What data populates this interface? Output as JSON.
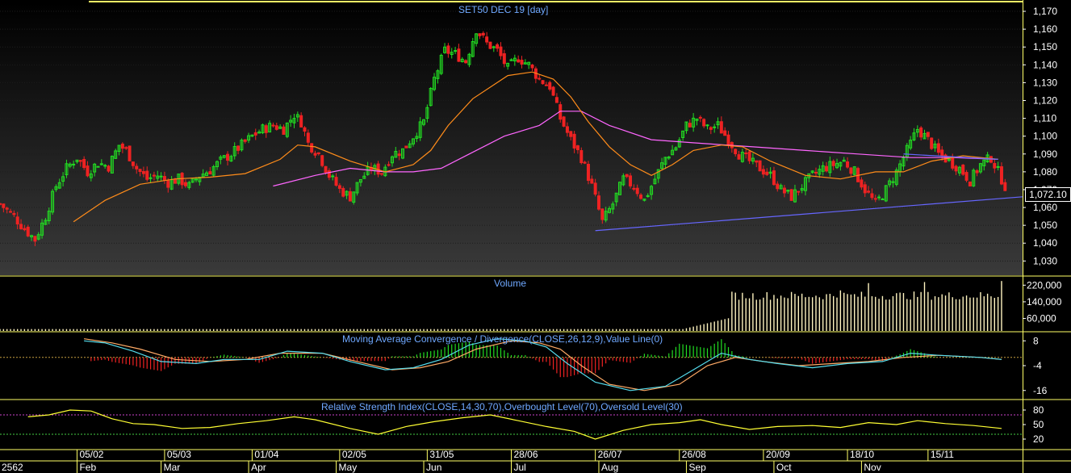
{
  "panels": {
    "price_title": "SET50 DEC 19   [day]",
    "volume_title": "Volume",
    "macd_title": "Moving Average Convergence / Divergence(CLOSE,26,12,9),Value Line(0)",
    "rsi_title": "Relative Strength Index(CLOSE,14,30,70),Overbought Level(70),Oversold Level(30)",
    "last_price": "1,072.10"
  },
  "colors": {
    "up": "#22dd22",
    "down": "#ee2222",
    "ma_fast": "#ff8c1a",
    "ma_slow": "#ff66ff",
    "trendline": "#6666ff",
    "volume": "#fff4c0",
    "macd_line": "#55ddee",
    "signal_line": "#ffaa66",
    "rsi_line": "#ffff33",
    "frame": "#ffff66",
    "axis_text": "#ffffff",
    "title_text": "#6fa8ff"
  },
  "chart_data": [
    {
      "type": "candlestick",
      "title": "SET50 DEC 19   [day]",
      "ylim": [
        1022,
        1175
      ],
      "yticks": [
        "1,170",
        "1,160",
        "1,150",
        "1,140",
        "1,130",
        "1,120",
        "1,110",
        "1,100",
        "1,090",
        "1,080",
        "1,070",
        "1,060",
        "1,050",
        "1,040",
        "1,030"
      ],
      "ytick_values": [
        1170,
        1160,
        1150,
        1140,
        1130,
        1120,
        1110,
        1100,
        1090,
        1080,
        1070,
        1060,
        1050,
        1040,
        1030
      ],
      "close_path": [
        [
          0,
          1062
        ],
        [
          4,
          1055
        ],
        [
          7,
          1048
        ],
        [
          10,
          1042
        ],
        [
          13,
          1055
        ],
        [
          16,
          1072
        ],
        [
          19,
          1082
        ],
        [
          22,
          1088
        ],
        [
          25,
          1080
        ],
        [
          28,
          1085
        ],
        [
          31,
          1083
        ],
        [
          34,
          1095
        ],
        [
          36,
          1092
        ],
        [
          39,
          1082
        ],
        [
          42,
          1076
        ],
        [
          45,
          1078
        ],
        [
          48,
          1074
        ],
        [
          51,
          1076
        ],
        [
          54,
          1072
        ],
        [
          57,
          1078
        ],
        [
          60,
          1081
        ],
        [
          63,
          1086
        ],
        [
          66,
          1090
        ],
        [
          69,
          1095
        ],
        [
          72,
          1100
        ],
        [
          75,
          1104
        ],
        [
          78,
          1106
        ],
        [
          81,
          1104
        ],
        [
          84,
          1112
        ],
        [
          86,
          1108
        ],
        [
          88,
          1096
        ],
        [
          91,
          1090
        ],
        [
          94,
          1078
        ],
        [
          97,
          1070
        ],
        [
          100,
          1066
        ],
        [
          103,
          1076
        ],
        [
          106,
          1082
        ],
        [
          109,
          1080
        ],
        [
          112,
          1090
        ],
        [
          115,
          1092
        ],
        [
          118,
          1100
        ],
        [
          121,
          1108
        ],
        [
          124,
          1132
        ],
        [
          127,
          1148
        ],
        [
          130,
          1146
        ],
        [
          133,
          1142
        ],
        [
          136,
          1160
        ],
        [
          139,
          1152
        ],
        [
          142,
          1148
        ],
        [
          145,
          1138
        ],
        [
          148,
          1144
        ],
        [
          151,
          1140
        ],
        [
          154,
          1132
        ],
        [
          157,
          1128
        ],
        [
          160,
          1110
        ],
        [
          163,
          1098
        ],
        [
          166,
          1088
        ],
        [
          169,
          1072
        ],
        [
          172,
          1052
        ],
        [
          175,
          1062
        ],
        [
          178,
          1076
        ],
        [
          181,
          1072
        ],
        [
          184,
          1064
        ],
        [
          187,
          1076
        ],
        [
          190,
          1088
        ],
        [
          193,
          1094
        ],
        [
          196,
          1106
        ],
        [
          199,
          1110
        ],
        [
          202,
          1104
        ],
        [
          205,
          1106
        ],
        [
          208,
          1098
        ],
        [
          211,
          1090
        ],
        [
          214,
          1086
        ],
        [
          217,
          1082
        ],
        [
          220,
          1078
        ],
        [
          223,
          1070
        ],
        [
          226,
          1066
        ],
        [
          229,
          1072
        ],
        [
          232,
          1078
        ],
        [
          235,
          1082
        ],
        [
          238,
          1084
        ],
        [
          241,
          1086
        ],
        [
          244,
          1080
        ],
        [
          247,
          1070
        ],
        [
          250,
          1062
        ],
        [
          253,
          1070
        ],
        [
          256,
          1080
        ],
        [
          259,
          1092
        ],
        [
          262,
          1104
        ],
        [
          265,
          1098
        ],
        [
          268,
          1090
        ],
        [
          271,
          1086
        ],
        [
          274,
          1082
        ],
        [
          277,
          1075
        ],
        [
          280,
          1084
        ],
        [
          283,
          1088
        ],
        [
          285,
          1080
        ],
        [
          287,
          1072
        ]
      ],
      "ma_fast_path": [
        [
          21,
          1052
        ],
        [
          30,
          1064
        ],
        [
          40,
          1073
        ],
        [
          50,
          1076
        ],
        [
          60,
          1077
        ],
        [
          70,
          1079
        ],
        [
          80,
          1087
        ],
        [
          85,
          1095
        ],
        [
          90,
          1094
        ],
        [
          100,
          1086
        ],
        [
          110,
          1080
        ],
        [
          118,
          1084
        ],
        [
          123,
          1092
        ],
        [
          128,
          1106
        ],
        [
          135,
          1121
        ],
        [
          145,
          1134
        ],
        [
          152,
          1136
        ],
        [
          158,
          1132
        ],
        [
          163,
          1122
        ],
        [
          168,
          1108
        ],
        [
          174,
          1094
        ],
        [
          180,
          1084
        ],
        [
          186,
          1078
        ],
        [
          192,
          1084
        ],
        [
          198,
          1092
        ],
        [
          206,
          1095
        ],
        [
          212,
          1094
        ],
        [
          220,
          1086
        ],
        [
          230,
          1078
        ],
        [
          240,
          1076
        ],
        [
          250,
          1080
        ],
        [
          258,
          1080
        ],
        [
          266,
          1086
        ],
        [
          275,
          1089
        ],
        [
          285,
          1087
        ]
      ],
      "ma_slow_path": [
        [
          78,
          1072
        ],
        [
          90,
          1078
        ],
        [
          100,
          1082
        ],
        [
          110,
          1080
        ],
        [
          118,
          1080
        ],
        [
          126,
          1082
        ],
        [
          134,
          1090
        ],
        [
          144,
          1100
        ],
        [
          154,
          1106
        ],
        [
          160,
          1114
        ],
        [
          166,
          1114
        ],
        [
          174,
          1106
        ],
        [
          186,
          1098
        ],
        [
          200,
          1096
        ],
        [
          215,
          1094
        ],
        [
          230,
          1092
        ],
        [
          245,
          1090
        ],
        [
          260,
          1088
        ],
        [
          272,
          1088
        ],
        [
          285,
          1087
        ]
      ],
      "trendline": [
        [
          170,
          1047
        ],
        [
          292,
          1066
        ]
      ],
      "last_price": 1072.1
    },
    {
      "type": "bar",
      "title": "Volume",
      "ylim": [
        0,
        260000
      ],
      "yticks": [
        "220,000",
        "140,000",
        "60,000"
      ],
      "ytick_values": [
        220000,
        140000,
        60000
      ],
      "segments": [
        {
          "from": 0,
          "to": 208,
          "value": 9000
        },
        {
          "from": 209,
          "to": 286,
          "value": 170000
        }
      ],
      "notable": [
        [
          216,
          150000
        ],
        [
          218,
          160000
        ],
        [
          240,
          195000
        ],
        [
          248,
          230000
        ],
        [
          264,
          235000
        ],
        [
          286,
          240000
        ]
      ]
    },
    {
      "type": "line",
      "title": "Moving Average Convergence / Divergence(CLOSE,26,12,9),Value Line(0)",
      "ylim": [
        -20,
        12
      ],
      "yticks": [
        "8",
        "-4",
        "-16"
      ],
      "ytick_values": [
        8,
        -4,
        -16
      ],
      "macd_path": [
        [
          24,
          8
        ],
        [
          30,
          7
        ],
        [
          38,
          3
        ],
        [
          46,
          -2
        ],
        [
          56,
          -3
        ],
        [
          64,
          -1
        ],
        [
          74,
          -1
        ],
        [
          82,
          3
        ],
        [
          92,
          2
        ],
        [
          100,
          -2
        ],
        [
          110,
          -6
        ],
        [
          118,
          -5
        ],
        [
          126,
          -1
        ],
        [
          134,
          6
        ],
        [
          142,
          9
        ],
        [
          150,
          8
        ],
        [
          156,
          5
        ],
        [
          162,
          -3
        ],
        [
          170,
          -12
        ],
        [
          180,
          -16
        ],
        [
          190,
          -14
        ],
        [
          198,
          -6
        ],
        [
          206,
          2
        ],
        [
          214,
          -1
        ],
        [
          222,
          -3
        ],
        [
          232,
          -5
        ],
        [
          242,
          -3
        ],
        [
          252,
          -2
        ],
        [
          260,
          2
        ],
        [
          268,
          1
        ],
        [
          280,
          0
        ],
        [
          286,
          -1
        ]
      ],
      "signal_path": [
        [
          24,
          9
        ],
        [
          32,
          7
        ],
        [
          40,
          4
        ],
        [
          50,
          -1
        ],
        [
          60,
          -2
        ],
        [
          70,
          -1
        ],
        [
          80,
          2
        ],
        [
          92,
          2
        ],
        [
          102,
          -2
        ],
        [
          112,
          -6
        ],
        [
          120,
          -5
        ],
        [
          128,
          -2
        ],
        [
          136,
          4
        ],
        [
          146,
          8
        ],
        [
          154,
          7
        ],
        [
          160,
          4
        ],
        [
          166,
          -4
        ],
        [
          174,
          -13
        ],
        [
          184,
          -16
        ],
        [
          194,
          -13
        ],
        [
          202,
          -4
        ],
        [
          210,
          0
        ],
        [
          218,
          -2
        ],
        [
          228,
          -4
        ],
        [
          238,
          -3
        ],
        [
          248,
          -2
        ],
        [
          258,
          0
        ],
        [
          268,
          1
        ],
        [
          280,
          0
        ],
        [
          286,
          -1
        ]
      ]
    },
    {
      "type": "line",
      "title": "Relative Strength Index(CLOSE,14,30,70),Overbought Level(70),Oversold Level(30)",
      "ylim": [
        0,
        100
      ],
      "yticks": [
        "80",
        "50",
        "20"
      ],
      "ytick_values": [
        80,
        50,
        20
      ],
      "overbought": 70,
      "oversold": 30,
      "rsi_path": [
        [
          8,
          66
        ],
        [
          14,
          70
        ],
        [
          20,
          80
        ],
        [
          26,
          78
        ],
        [
          32,
          62
        ],
        [
          38,
          52
        ],
        [
          44,
          50
        ],
        [
          52,
          42
        ],
        [
          60,
          44
        ],
        [
          68,
          52
        ],
        [
          76,
          58
        ],
        [
          84,
          66
        ],
        [
          90,
          60
        ],
        [
          100,
          42
        ],
        [
          108,
          30
        ],
        [
          116,
          46
        ],
        [
          124,
          56
        ],
        [
          132,
          64
        ],
        [
          140,
          70
        ],
        [
          148,
          58
        ],
        [
          156,
          46
        ],
        [
          164,
          36
        ],
        [
          170,
          20
        ],
        [
          178,
          38
        ],
        [
          186,
          50
        ],
        [
          194,
          54
        ],
        [
          200,
          60
        ],
        [
          206,
          50
        ],
        [
          214,
          40
        ],
        [
          222,
          46
        ],
        [
          232,
          48
        ],
        [
          240,
          44
        ],
        [
          248,
          54
        ],
        [
          256,
          50
        ],
        [
          262,
          58
        ],
        [
          270,
          52
        ],
        [
          278,
          48
        ],
        [
          286,
          42
        ]
      ]
    }
  ],
  "xaxis": {
    "domain": [
      0,
      292
    ],
    "year": "2562",
    "dates": [
      {
        "label": "05/02",
        "x": 22
      },
      {
        "label": "05/03",
        "x": 47
      },
      {
        "label": "01/04",
        "x": 72
      },
      {
        "label": "02/05",
        "x": 97
      },
      {
        "label": "31/05",
        "x": 122
      },
      {
        "label": "28/06",
        "x": 146
      },
      {
        "label": "26/07",
        "x": 170
      },
      {
        "label": "26/08",
        "x": 194
      },
      {
        "label": "20/09",
        "x": 218
      },
      {
        "label": "18/10",
        "x": 242
      },
      {
        "label": "15/11",
        "x": 265
      }
    ],
    "months": [
      {
        "label": "Feb",
        "x": 22
      },
      {
        "label": "Mar",
        "x": 46
      },
      {
        "label": "Apr",
        "x": 71
      },
      {
        "label": "May",
        "x": 96
      },
      {
        "label": "Jun",
        "x": 121
      },
      {
        "label": "Jul",
        "x": 146
      },
      {
        "label": "Aug",
        "x": 171
      },
      {
        "label": "Sep",
        "x": 196
      },
      {
        "label": "Oct",
        "x": 221
      },
      {
        "label": "Nov",
        "x": 246
      }
    ]
  }
}
